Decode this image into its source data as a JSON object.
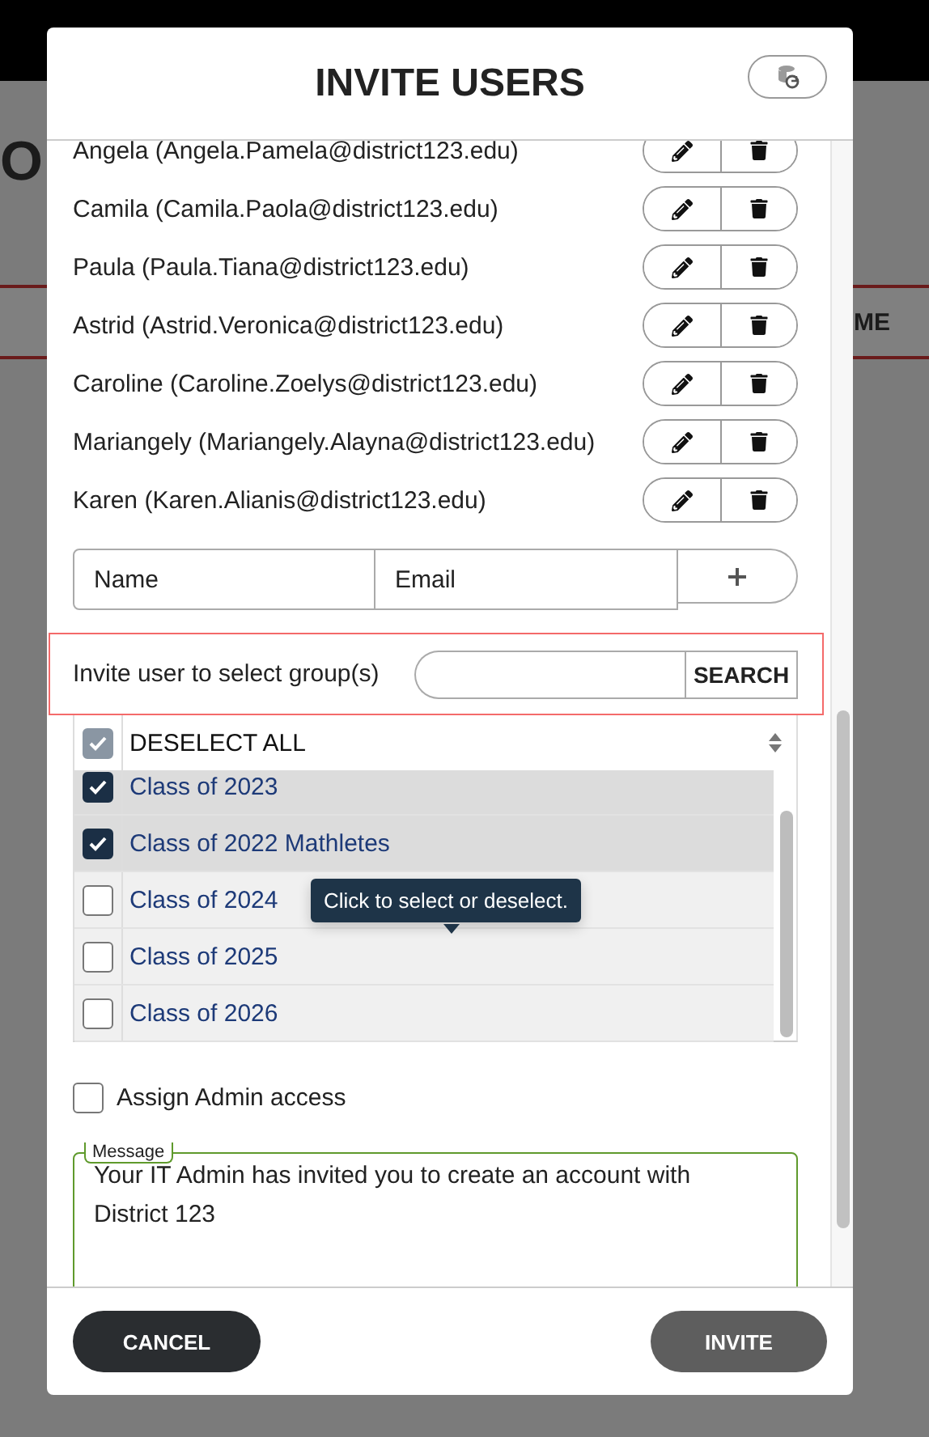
{
  "background": {
    "page_title": "O",
    "column_header": "ME"
  },
  "dialog": {
    "title": "INVITE USERS",
    "users": [
      {
        "label": "Angela (Angela.Pamela@district123.edu)"
      },
      {
        "label": "Camila (Camila.Paola@district123.edu)"
      },
      {
        "label": "Paula (Paula.Tiana@district123.edu)"
      },
      {
        "label": "Astrid (Astrid.Veronica@district123.edu)"
      },
      {
        "label": "Caroline (Caroline.Zoelys@district123.edu)"
      },
      {
        "label": "Mariangely (Mariangely.Alayna@district123.edu)"
      },
      {
        "label": "Karen (Karen.Alianis@district123.edu)"
      }
    ],
    "new_user": {
      "name_placeholder": "Name",
      "email_placeholder": "Email"
    },
    "group_search": {
      "label": "Invite user to select group(s)",
      "button": "SEARCH"
    },
    "group_list": {
      "select_all": {
        "label": "DESELECT ALL",
        "checked": true
      },
      "groups": [
        {
          "label": "Class of 2023",
          "checked": true
        },
        {
          "label": "Class of 2022 Mathletes",
          "checked": true
        },
        {
          "label": "Class of 2024",
          "checked": false
        },
        {
          "label": "Class of 2025",
          "checked": false
        },
        {
          "label": "Class of 2026",
          "checked": false
        }
      ],
      "tooltip": "Click to select or deselect."
    },
    "admin_access": {
      "label": "Assign Admin access",
      "checked": false
    },
    "message": {
      "legend": "Message",
      "value": "Your IT Admin has invited you to create an account with District 123"
    },
    "buttons": {
      "cancel": "CANCEL",
      "invite": "INVITE"
    }
  }
}
